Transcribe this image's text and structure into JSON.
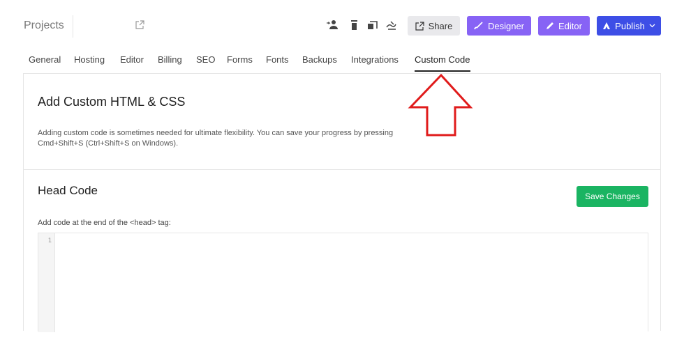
{
  "topbar": {
    "projects_label": "Projects",
    "icons": [
      "external-link-icon",
      "person-icon",
      "trash-icon",
      "stack-icon",
      "gesture-icon"
    ],
    "buttons": {
      "share": "Share",
      "designer": "Designer",
      "editor": "Editor",
      "publish": "Publish"
    }
  },
  "tabs": [
    {
      "label": "General"
    },
    {
      "label": "Hosting"
    },
    {
      "label": "Editor"
    },
    {
      "label": "Billing"
    },
    {
      "label": "SEO"
    },
    {
      "label": "Forms"
    },
    {
      "label": "Fonts"
    },
    {
      "label": "Backups"
    },
    {
      "label": "Integrations"
    },
    {
      "label": "Custom Code",
      "active": true
    }
  ],
  "custom_code": {
    "title": "Add Custom HTML & CSS",
    "description": "Adding custom code is sometimes needed for ultimate flexibility. You can save your progress by pressing Cmd+Shift+S (Ctrl+Shift+S on Windows).",
    "head_title": "Head Code",
    "save_label": "Save Changes",
    "head_label": "Add code at the end of the <head> tag:",
    "line_number": "1"
  },
  "colors": {
    "designer": "#8763f5",
    "editor": "#8763f5",
    "publish": "#3d4ee6",
    "save": "#1ab462",
    "annotation_arrow": "#e01b1b"
  }
}
